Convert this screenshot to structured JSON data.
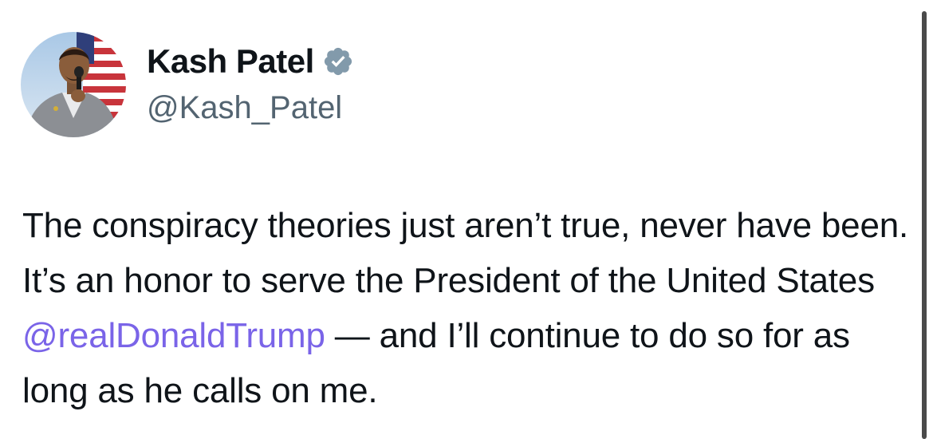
{
  "tweet": {
    "author": {
      "display_name": "Kash Patel",
      "handle": "@Kash_Patel",
      "verified_icon": "verified-badge-icon",
      "avatar_icon": "profile-avatar"
    },
    "text_parts": {
      "part1": "The conspiracy theories just aren’t true, never have been. It’s an honor to serve the President of the United States ",
      "mention": "@realDonaldTrump",
      "part2": " — and I’ll continue to do so for as long as he calls on me."
    },
    "colors": {
      "text": "#0f1419",
      "handle": "#536471",
      "mention": "#7a64e8",
      "verified_badge": "#829aab"
    }
  }
}
